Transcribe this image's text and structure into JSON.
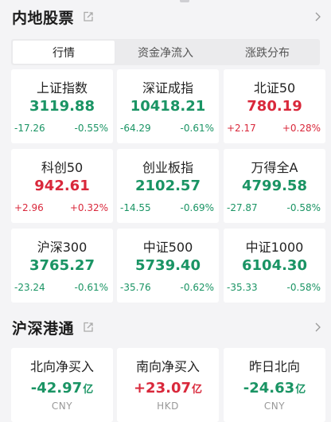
{
  "mainland": {
    "title": "内地股票",
    "tabs": [
      "行情",
      "资金净流入",
      "涨跌分布"
    ],
    "indices": [
      {
        "name": "上证指数",
        "price": "3119.88",
        "change": "-17.26",
        "pct": "-0.55%",
        "dir": "down"
      },
      {
        "name": "深证成指",
        "price": "10418.21",
        "change": "-64.29",
        "pct": "-0.61%",
        "dir": "down"
      },
      {
        "name": "北证50",
        "price": "780.19",
        "change": "+2.17",
        "pct": "+0.28%",
        "dir": "up"
      },
      {
        "name": "科创50",
        "price": "942.61",
        "change": "+2.96",
        "pct": "+0.32%",
        "dir": "up"
      },
      {
        "name": "创业板指",
        "price": "2102.57",
        "change": "-14.55",
        "pct": "-0.69%",
        "dir": "down"
      },
      {
        "name": "万得全A",
        "price": "4799.58",
        "change": "-27.87",
        "pct": "-0.58%",
        "dir": "down"
      },
      {
        "name": "沪深300",
        "price": "3765.27",
        "change": "-23.24",
        "pct": "-0.61%",
        "dir": "down"
      },
      {
        "name": "中证500",
        "price": "5739.40",
        "change": "-35.76",
        "pct": "-0.62%",
        "dir": "down"
      },
      {
        "name": "中证1000",
        "price": "6104.30",
        "change": "-35.33",
        "pct": "-0.58%",
        "dir": "down"
      }
    ]
  },
  "connect": {
    "title": "沪深港通",
    "flows": [
      {
        "name": "北向净买入",
        "value": "-42.97",
        "unit": "亿",
        "currency": "CNY",
        "dir": "down"
      },
      {
        "name": "南向净买入",
        "value": "+23.07",
        "unit": "亿",
        "currency": "HKD",
        "dir": "up"
      },
      {
        "name": "昨日北向",
        "value": "-24.63",
        "unit": "亿",
        "currency": "CNY",
        "dir": "down"
      }
    ]
  },
  "colors": {
    "up": "#d9283b",
    "down": "#1a9464",
    "background": "#f4f4f6",
    "card": "#ffffff"
  },
  "icons": {
    "share": "share-out-icon",
    "chevron": "chevron-right-icon"
  }
}
